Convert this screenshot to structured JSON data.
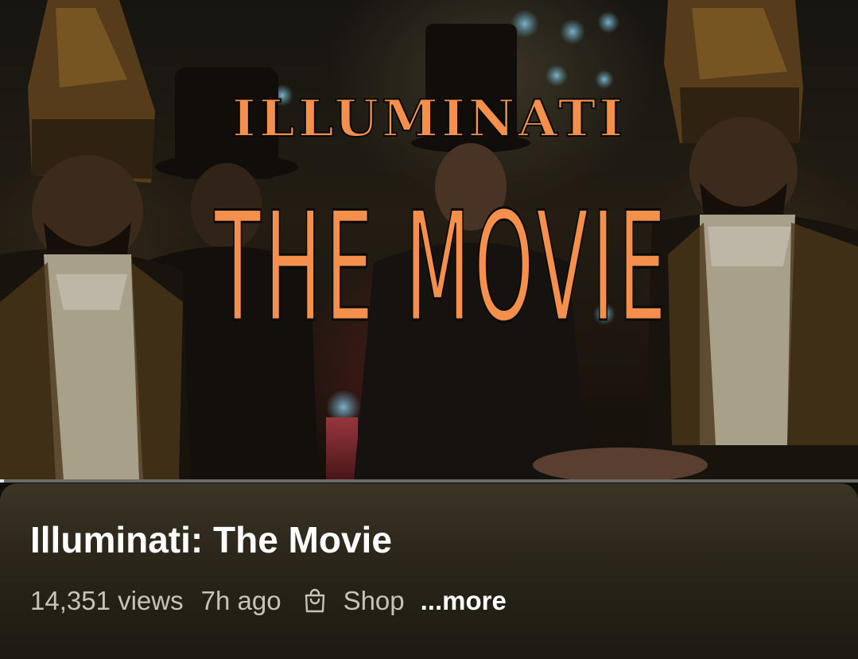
{
  "thumbnail": {
    "title_line1": "ILLUMINATI",
    "title_line2": "THE MOVIE",
    "title_color": "#f4904c"
  },
  "player": {
    "progress_fraction": 0.005
  },
  "video": {
    "title": "Illuminati: The Movie",
    "views": "14,351 views",
    "age": "7h ago",
    "shop_icon": "shopping-bag-icon",
    "shop_label": "Shop",
    "more_label": "...more"
  },
  "colors": {
    "panel_bg": "#2a2519",
    "title_text": "#ffffff",
    "meta_text": "#c7c3b8"
  }
}
